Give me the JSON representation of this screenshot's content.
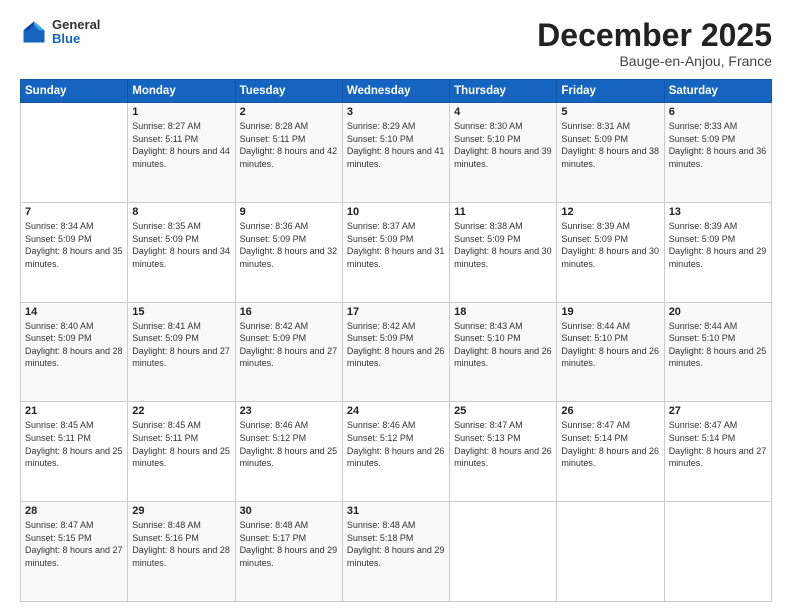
{
  "header": {
    "logo": {
      "general": "General",
      "blue": "Blue"
    },
    "title": "December 2025",
    "location": "Bauge-en-Anjou, France"
  },
  "days_of_week": [
    "Sunday",
    "Monday",
    "Tuesday",
    "Wednesday",
    "Thursday",
    "Friday",
    "Saturday"
  ],
  "weeks": [
    [
      {
        "day": "",
        "sunrise": "",
        "sunset": "",
        "daylight": ""
      },
      {
        "day": "1",
        "sunrise": "Sunrise: 8:27 AM",
        "sunset": "Sunset: 5:11 PM",
        "daylight": "Daylight: 8 hours and 44 minutes."
      },
      {
        "day": "2",
        "sunrise": "Sunrise: 8:28 AM",
        "sunset": "Sunset: 5:11 PM",
        "daylight": "Daylight: 8 hours and 42 minutes."
      },
      {
        "day": "3",
        "sunrise": "Sunrise: 8:29 AM",
        "sunset": "Sunset: 5:10 PM",
        "daylight": "Daylight: 8 hours and 41 minutes."
      },
      {
        "day": "4",
        "sunrise": "Sunrise: 8:30 AM",
        "sunset": "Sunset: 5:10 PM",
        "daylight": "Daylight: 8 hours and 39 minutes."
      },
      {
        "day": "5",
        "sunrise": "Sunrise: 8:31 AM",
        "sunset": "Sunset: 5:09 PM",
        "daylight": "Daylight: 8 hours and 38 minutes."
      },
      {
        "day": "6",
        "sunrise": "Sunrise: 8:33 AM",
        "sunset": "Sunset: 5:09 PM",
        "daylight": "Daylight: 8 hours and 36 minutes."
      }
    ],
    [
      {
        "day": "7",
        "sunrise": "Sunrise: 8:34 AM",
        "sunset": "Sunset: 5:09 PM",
        "daylight": "Daylight: 8 hours and 35 minutes."
      },
      {
        "day": "8",
        "sunrise": "Sunrise: 8:35 AM",
        "sunset": "Sunset: 5:09 PM",
        "daylight": "Daylight: 8 hours and 34 minutes."
      },
      {
        "day": "9",
        "sunrise": "Sunrise: 8:36 AM",
        "sunset": "Sunset: 5:09 PM",
        "daylight": "Daylight: 8 hours and 32 minutes."
      },
      {
        "day": "10",
        "sunrise": "Sunrise: 8:37 AM",
        "sunset": "Sunset: 5:09 PM",
        "daylight": "Daylight: 8 hours and 31 minutes."
      },
      {
        "day": "11",
        "sunrise": "Sunrise: 8:38 AM",
        "sunset": "Sunset: 5:09 PM",
        "daylight": "Daylight: 8 hours and 30 minutes."
      },
      {
        "day": "12",
        "sunrise": "Sunrise: 8:39 AM",
        "sunset": "Sunset: 5:09 PM",
        "daylight": "Daylight: 8 hours and 30 minutes."
      },
      {
        "day": "13",
        "sunrise": "Sunrise: 8:39 AM",
        "sunset": "Sunset: 5:09 PM",
        "daylight": "Daylight: 8 hours and 29 minutes."
      }
    ],
    [
      {
        "day": "14",
        "sunrise": "Sunrise: 8:40 AM",
        "sunset": "Sunset: 5:09 PM",
        "daylight": "Daylight: 8 hours and 28 minutes."
      },
      {
        "day": "15",
        "sunrise": "Sunrise: 8:41 AM",
        "sunset": "Sunset: 5:09 PM",
        "daylight": "Daylight: 8 hours and 27 minutes."
      },
      {
        "day": "16",
        "sunrise": "Sunrise: 8:42 AM",
        "sunset": "Sunset: 5:09 PM",
        "daylight": "Daylight: 8 hours and 27 minutes."
      },
      {
        "day": "17",
        "sunrise": "Sunrise: 8:42 AM",
        "sunset": "Sunset: 5:09 PM",
        "daylight": "Daylight: 8 hours and 26 minutes."
      },
      {
        "day": "18",
        "sunrise": "Sunrise: 8:43 AM",
        "sunset": "Sunset: 5:10 PM",
        "daylight": "Daylight: 8 hours and 26 minutes."
      },
      {
        "day": "19",
        "sunrise": "Sunrise: 8:44 AM",
        "sunset": "Sunset: 5:10 PM",
        "daylight": "Daylight: 8 hours and 26 minutes."
      },
      {
        "day": "20",
        "sunrise": "Sunrise: 8:44 AM",
        "sunset": "Sunset: 5:10 PM",
        "daylight": "Daylight: 8 hours and 25 minutes."
      }
    ],
    [
      {
        "day": "21",
        "sunrise": "Sunrise: 8:45 AM",
        "sunset": "Sunset: 5:11 PM",
        "daylight": "Daylight: 8 hours and 25 minutes."
      },
      {
        "day": "22",
        "sunrise": "Sunrise: 8:45 AM",
        "sunset": "Sunset: 5:11 PM",
        "daylight": "Daylight: 8 hours and 25 minutes."
      },
      {
        "day": "23",
        "sunrise": "Sunrise: 8:46 AM",
        "sunset": "Sunset: 5:12 PM",
        "daylight": "Daylight: 8 hours and 25 minutes."
      },
      {
        "day": "24",
        "sunrise": "Sunrise: 8:46 AM",
        "sunset": "Sunset: 5:12 PM",
        "daylight": "Daylight: 8 hours and 26 minutes."
      },
      {
        "day": "25",
        "sunrise": "Sunrise: 8:47 AM",
        "sunset": "Sunset: 5:13 PM",
        "daylight": "Daylight: 8 hours and 26 minutes."
      },
      {
        "day": "26",
        "sunrise": "Sunrise: 8:47 AM",
        "sunset": "Sunset: 5:14 PM",
        "daylight": "Daylight: 8 hours and 26 minutes."
      },
      {
        "day": "27",
        "sunrise": "Sunrise: 8:47 AM",
        "sunset": "Sunset: 5:14 PM",
        "daylight": "Daylight: 8 hours and 27 minutes."
      }
    ],
    [
      {
        "day": "28",
        "sunrise": "Sunrise: 8:47 AM",
        "sunset": "Sunset: 5:15 PM",
        "daylight": "Daylight: 8 hours and 27 minutes."
      },
      {
        "day": "29",
        "sunrise": "Sunrise: 8:48 AM",
        "sunset": "Sunset: 5:16 PM",
        "daylight": "Daylight: 8 hours and 28 minutes."
      },
      {
        "day": "30",
        "sunrise": "Sunrise: 8:48 AM",
        "sunset": "Sunset: 5:17 PM",
        "daylight": "Daylight: 8 hours and 29 minutes."
      },
      {
        "day": "31",
        "sunrise": "Sunrise: 8:48 AM",
        "sunset": "Sunset: 5:18 PM",
        "daylight": "Daylight: 8 hours and 29 minutes."
      },
      {
        "day": "",
        "sunrise": "",
        "sunset": "",
        "daylight": ""
      },
      {
        "day": "",
        "sunrise": "",
        "sunset": "",
        "daylight": ""
      },
      {
        "day": "",
        "sunrise": "",
        "sunset": "",
        "daylight": ""
      }
    ]
  ]
}
